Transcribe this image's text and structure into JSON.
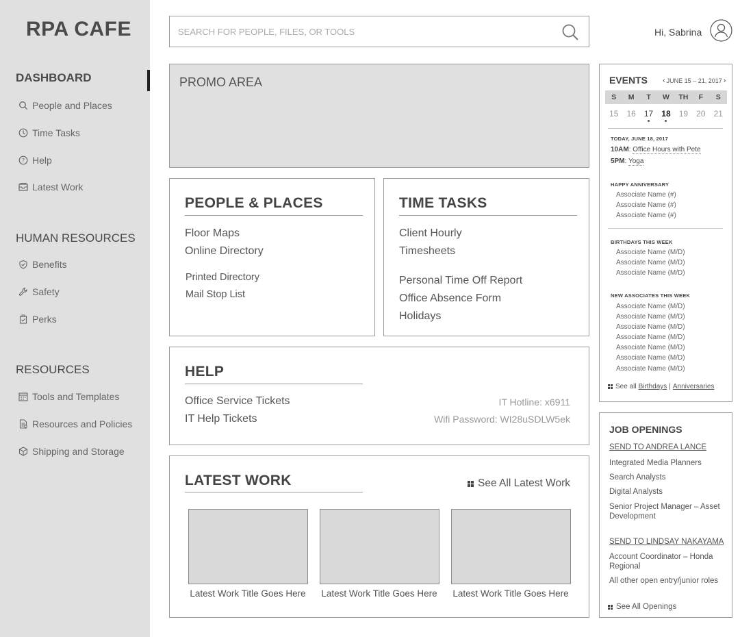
{
  "app": {
    "brand": "RPA CAFE"
  },
  "sidebar": {
    "sections": [
      {
        "title": "DASHBOARD",
        "items": [
          "People and Places",
          "Time Tasks",
          "Help",
          "Latest Work"
        ]
      },
      {
        "title": "HUMAN RESOURCES",
        "items": [
          "Benefits",
          "Safety",
          "Perks"
        ]
      },
      {
        "title": "RESOURCES",
        "items": [
          "Tools and Templates",
          "Resources and Policies",
          "Shipping and Storage"
        ]
      }
    ]
  },
  "header": {
    "search_placeholder": "SEARCH FOR PEOPLE, FILES, OR TOOLS",
    "greeting": "Hi, Sabrina"
  },
  "promo": {
    "label": "PROMO AREA"
  },
  "people_places": {
    "title": "PEOPLE & PLACES",
    "links": [
      "Floor Maps",
      "Online Directory",
      "Printed Directory",
      "Mail Stop List"
    ]
  },
  "time_tasks": {
    "title": "TIME TASKS",
    "links": [
      "Client Hourly",
      "Timesheets",
      "Personal Time Off Report",
      "Office Absence Form",
      "Holidays"
    ]
  },
  "help": {
    "title": "HELP",
    "links": [
      "Office Service Tickets",
      "IT Help Tickets"
    ],
    "hotline": "IT Hotline: x6911",
    "wifi": "Wifi Password: WI28uSDLW5ek"
  },
  "latest_work": {
    "title": "LATEST WORK",
    "see_all": "See All Latest Work",
    "items": [
      "Latest Work Title Goes Here",
      "Latest Work Title Goes Here",
      "Latest Work Title Goes Here"
    ]
  },
  "events": {
    "title": "EVENTS",
    "range": "JUNE 15 – 21, 2017",
    "weekdays": [
      "S",
      "M",
      "T",
      "W",
      "TH",
      "F",
      "S"
    ],
    "days": [
      "15",
      "16",
      "17",
      "18",
      "19",
      "20",
      "21"
    ],
    "today_heading": "TODAY, JUNE 18, 2017",
    "today_events": [
      {
        "time": "10AM",
        "name": "Office Hours with Pete"
      },
      {
        "time": "5PM",
        "name": "Yoga"
      }
    ],
    "anniversary_heading": "HAPPY ANNIVERSARY",
    "anniversaries": [
      "Associate Name (#)",
      "Associate Name (#)",
      "Associate Name (#)"
    ],
    "birthdays_heading": "BIRTHDAYS THIS WEEK",
    "birthdays": [
      "Associate Name (M/D)",
      "Associate Name (M/D)",
      "Associate Name (M/D)"
    ],
    "new_heading": "NEW ASSOCIATES THIS WEEK",
    "new_associates": [
      "Associate Name (M/D)",
      "Associate Name (M/D)",
      "Associate Name (M/D)",
      "Associate Name (M/D)",
      "Associate Name (M/D)",
      "Associate Name (M/D)",
      "Associate Name (M/D)"
    ],
    "footer_prefix": "See all",
    "footer_birthdays": "Birthdays",
    "footer_sep": "|",
    "footer_anniversaries": "Anniversaries"
  },
  "jobs": {
    "title": "JOB OPENINGS",
    "send1": "SEND TO ANDREA LANCE",
    "group1": [
      "Integrated Media Planners",
      "Search Analysts",
      "Digital Analysts",
      "Senior Project Manager – Asset Development"
    ],
    "send2": "SEND TO LINDSAY NAKAYAMA",
    "group2": [
      "Account Coordinator – Honda Regional",
      "All other open entry/junior roles"
    ],
    "see_all": "See All Openings"
  }
}
